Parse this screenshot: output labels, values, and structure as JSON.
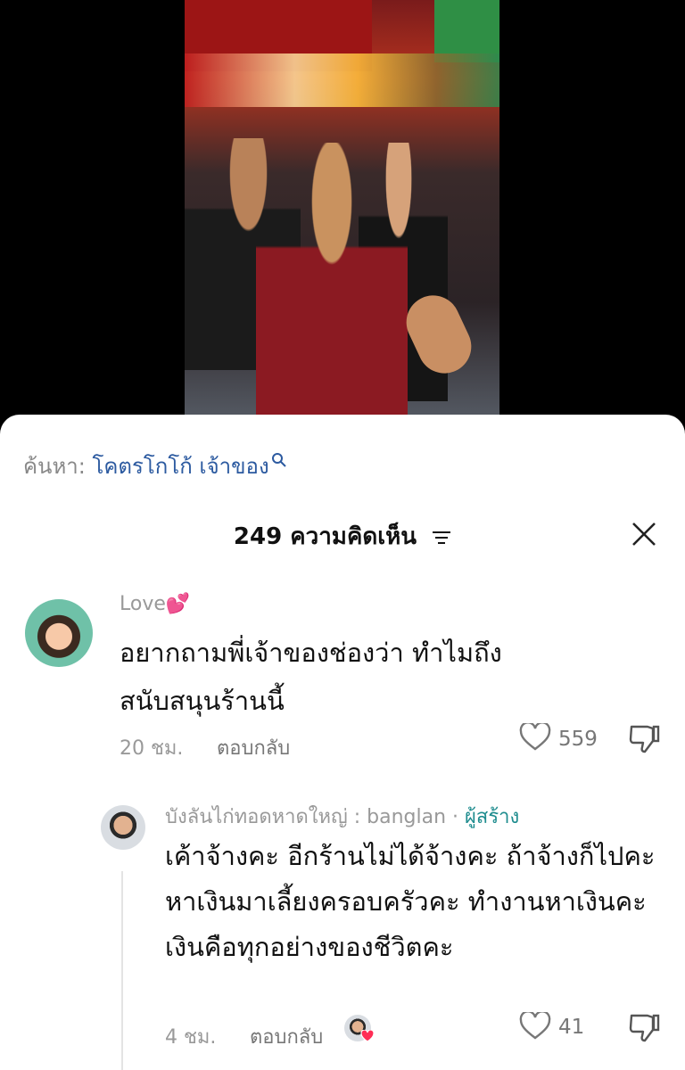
{
  "search": {
    "prefix": "ค้นหา:",
    "query": "โคตรโกโก้ เจ้าของ",
    "icon": "search-icon"
  },
  "comments_header": {
    "title": "249 ความคิดเห็น",
    "filter_icon": "filter-icon",
    "close_icon": "close-icon"
  },
  "comments": [
    {
      "username": "Love💕",
      "text": "อยากถามพี่เจ้าของช่องว่า ทำไมถึงสนับสนุนร้านนี้",
      "time": "20 ชม.",
      "reply_label": "ตอบกลับ",
      "likes": "559"
    }
  ],
  "reply": {
    "username": "บังลันไก่ทอดหาดใหญ่ : banglan",
    "separator": " · ",
    "creator_badge": "ผู้สร้าง",
    "text": "เค้าจ้างคะ อีกร้านไม่ได้จ้างคะ ถ้าจ้างก็ไปคะ หาเงินมาเลี้ยงครอบครัวคะ ทำงานหาเงินคะ เงินคือทุกอย่างของชีวิตคะ",
    "time": "4 ชม.",
    "reply_label": "ตอบกลับ",
    "likes": "41"
  },
  "colors": {
    "creator": "#1e8c8e",
    "search_link": "#2c5aa0",
    "heart_badge": "#ff2d55"
  }
}
